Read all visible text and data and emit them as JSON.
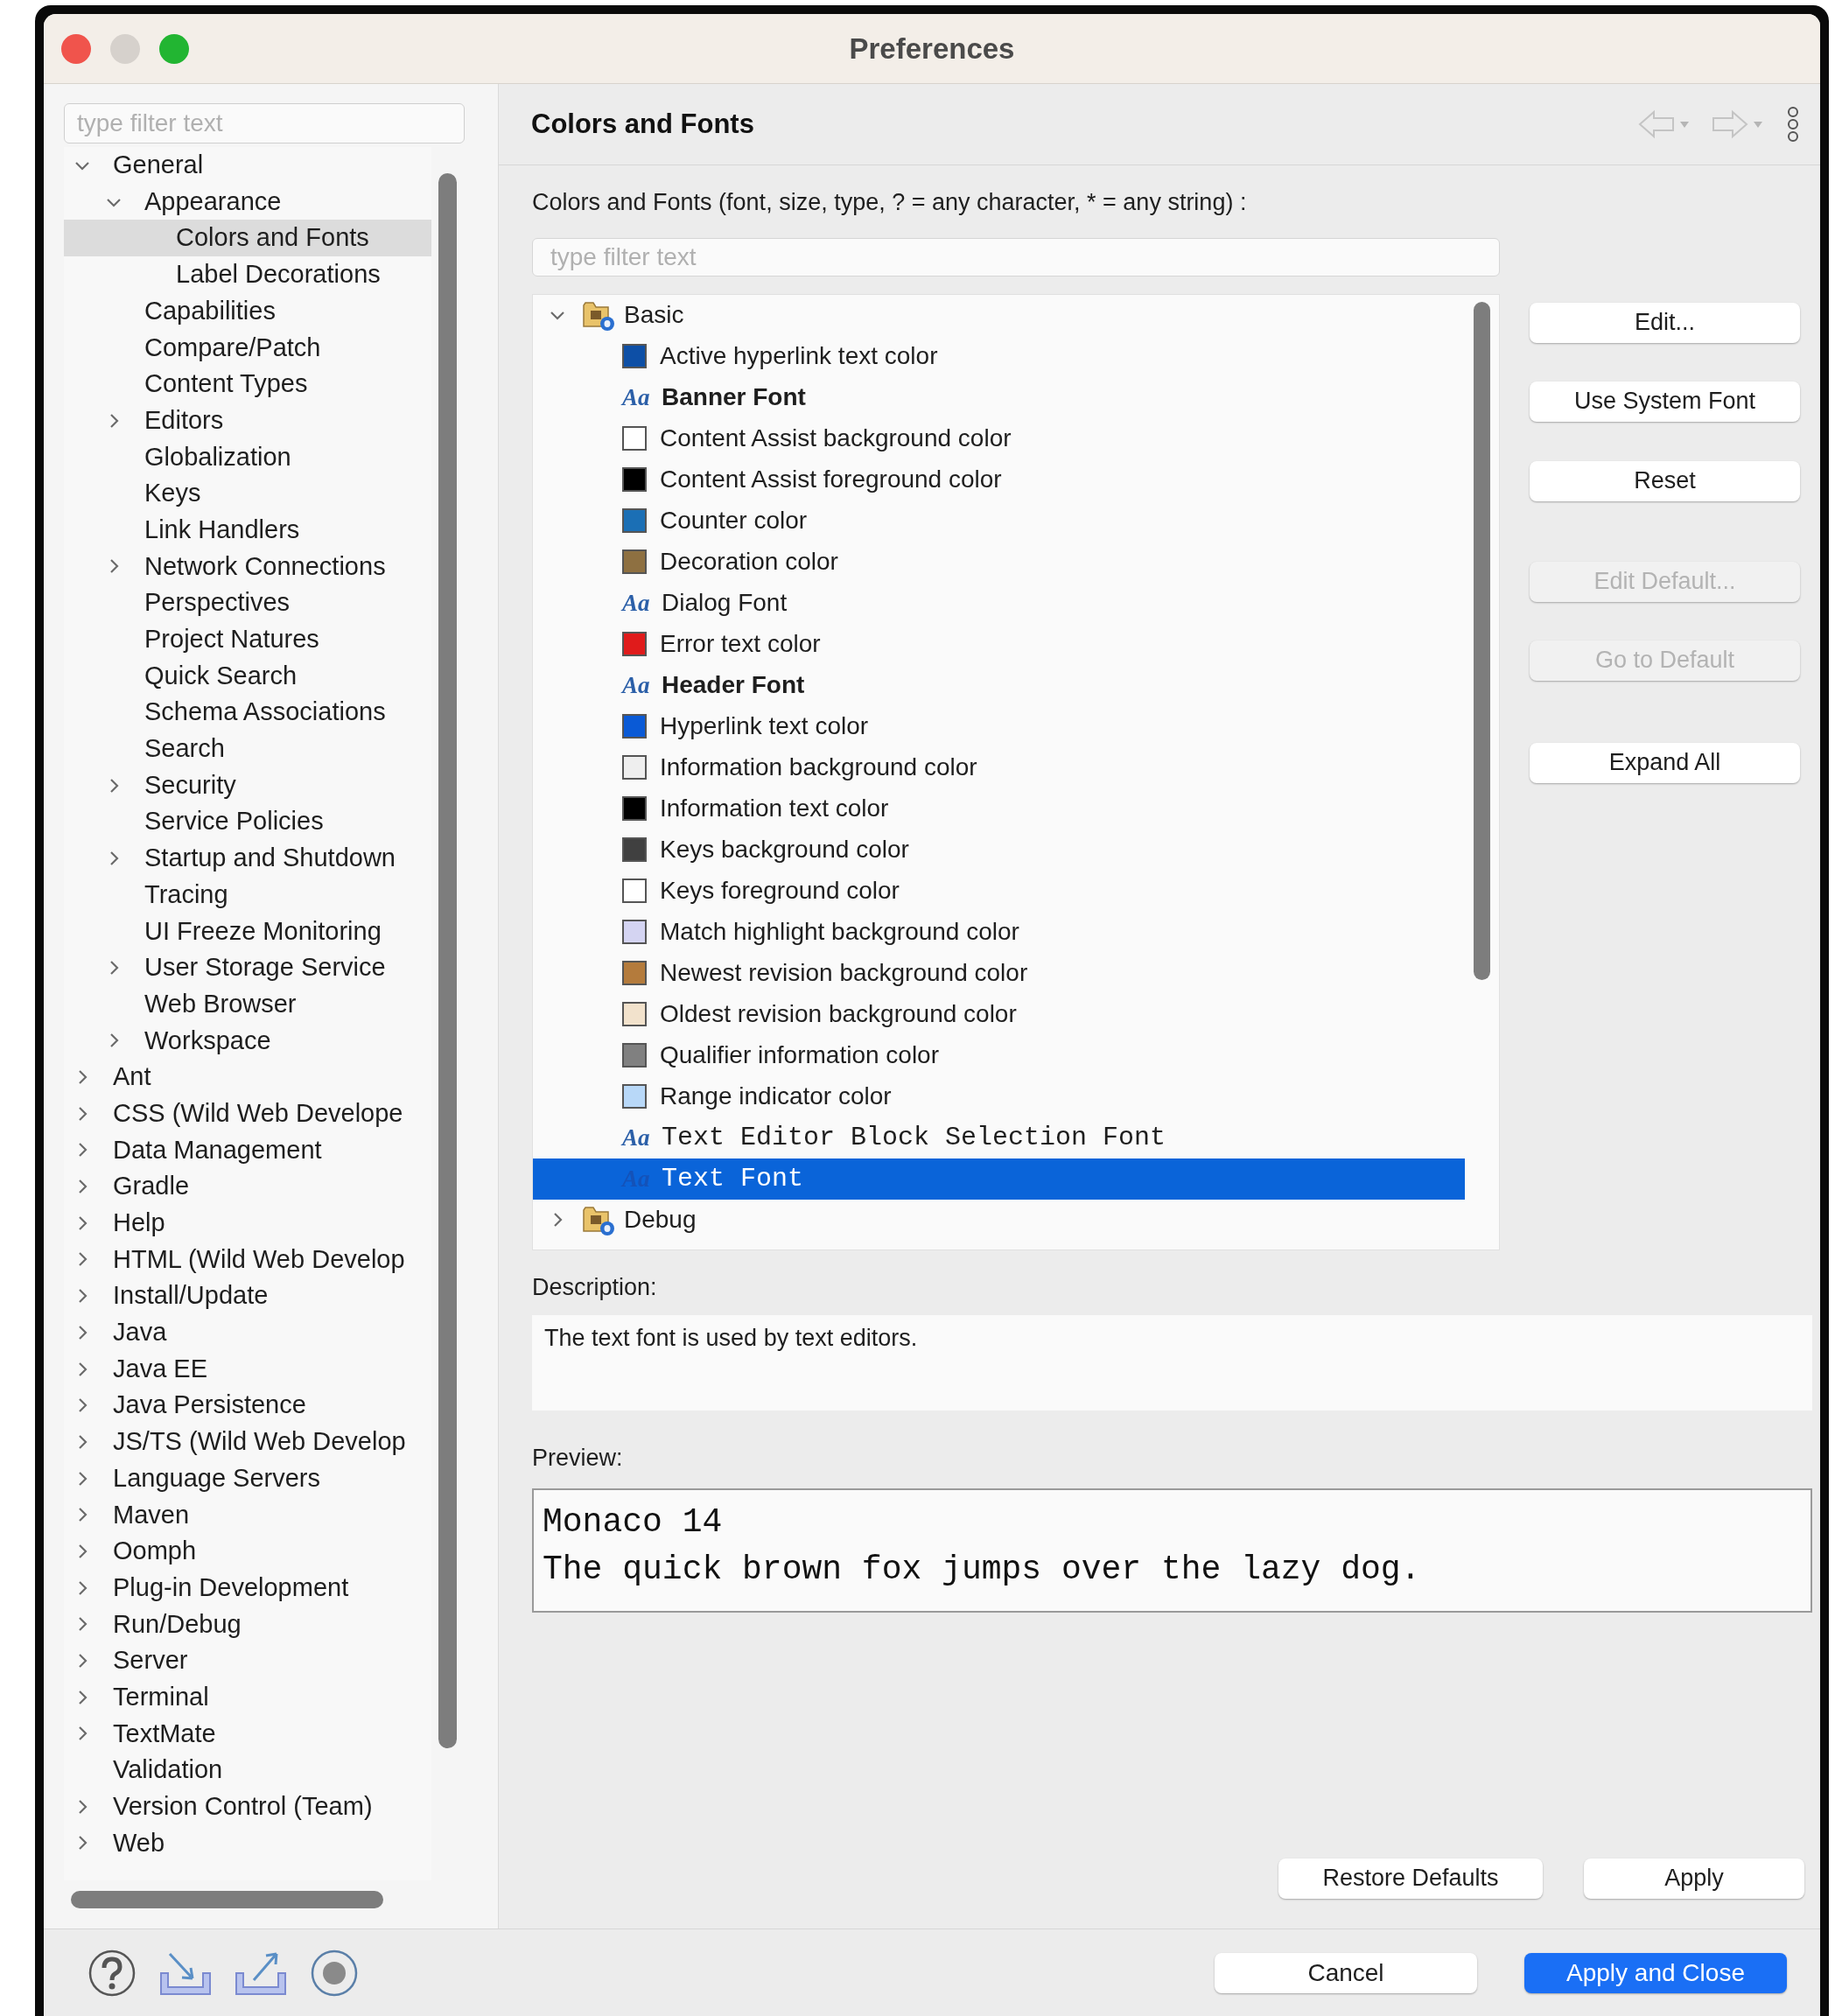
{
  "window": {
    "title": "Preferences"
  },
  "sidebar": {
    "filter": {
      "placeholder": "type filter text"
    },
    "tree": [
      {
        "label": "General",
        "expanded": true,
        "selected": false,
        "children": [
          {
            "label": "Appearance",
            "expanded": true,
            "selected": false,
            "children": [
              {
                "label": "Colors and Fonts",
                "selected": true
              },
              {
                "label": "Label Decorations",
                "selected": false
              }
            ]
          },
          {
            "label": "Capabilities",
            "selected": false
          },
          {
            "label": "Compare/Patch",
            "selected": false
          },
          {
            "label": "Content Types",
            "selected": false
          },
          {
            "label": "Editors",
            "expanded": false,
            "selected": false
          },
          {
            "label": "Globalization",
            "selected": false
          },
          {
            "label": "Keys",
            "selected": false
          },
          {
            "label": "Link Handlers",
            "selected": false
          },
          {
            "label": "Network Connections",
            "expanded": false,
            "selected": false
          },
          {
            "label": "Perspectives",
            "selected": false
          },
          {
            "label": "Project Natures",
            "selected": false
          },
          {
            "label": "Quick Search",
            "selected": false
          },
          {
            "label": "Schema Associations",
            "selected": false
          },
          {
            "label": "Search",
            "selected": false
          },
          {
            "label": "Security",
            "expanded": false,
            "selected": false
          },
          {
            "label": "Service Policies",
            "selected": false
          },
          {
            "label": "Startup and Shutdown",
            "expanded": false,
            "selected": false
          },
          {
            "label": "Tracing",
            "selected": false
          },
          {
            "label": "UI Freeze Monitoring",
            "selected": false
          },
          {
            "label": "User Storage Service",
            "expanded": false,
            "selected": false
          },
          {
            "label": "Web Browser",
            "selected": false
          },
          {
            "label": "Workspace",
            "expanded": false,
            "selected": false
          }
        ]
      },
      {
        "label": "Ant",
        "expanded": false,
        "selected": false
      },
      {
        "label": "CSS (Wild Web Develope",
        "expanded": false,
        "selected": false
      },
      {
        "label": "Data Management",
        "expanded": false,
        "selected": false
      },
      {
        "label": "Gradle",
        "expanded": false,
        "selected": false
      },
      {
        "label": "Help",
        "expanded": false,
        "selected": false
      },
      {
        "label": "HTML (Wild Web Develop",
        "expanded": false,
        "selected": false
      },
      {
        "label": "Install/Update",
        "expanded": false,
        "selected": false
      },
      {
        "label": "Java",
        "expanded": false,
        "selected": false
      },
      {
        "label": "Java EE",
        "expanded": false,
        "selected": false
      },
      {
        "label": "Java Persistence",
        "expanded": false,
        "selected": false
      },
      {
        "label": "JS/TS (Wild Web Develop",
        "expanded": false,
        "selected": false
      },
      {
        "label": "Language Servers",
        "expanded": false,
        "selected": false
      },
      {
        "label": "Maven",
        "expanded": false,
        "selected": false
      },
      {
        "label": "Oomph",
        "expanded": false,
        "selected": false
      },
      {
        "label": "Plug-in Development",
        "expanded": false,
        "selected": false
      },
      {
        "label": "Run/Debug",
        "expanded": false,
        "selected": false
      },
      {
        "label": "Server",
        "expanded": false,
        "selected": false
      },
      {
        "label": "Terminal",
        "expanded": false,
        "selected": false
      },
      {
        "label": "TextMate",
        "expanded": false,
        "selected": false
      },
      {
        "label": "Validation",
        "selected": false
      },
      {
        "label": "Version Control (Team)",
        "expanded": false,
        "selected": false
      },
      {
        "label": "Web",
        "expanded": false,
        "selected": false
      }
    ]
  },
  "page": {
    "title": "Colors and Fonts",
    "filter_label": "Colors and Fonts (font, size, type, ? = any character, * = any string) :",
    "filter": {
      "placeholder": "type filter text"
    },
    "tree": [
      {
        "label": "Basic",
        "expanded": true,
        "selected": false,
        "children": [
          {
            "label": "Active hyperlink text color",
            "kind": "color",
            "color": "#0d4fa6",
            "selected": false
          },
          {
            "label": "Banner Font",
            "kind": "boldfont",
            "icon": "Aa",
            "selected": false
          },
          {
            "label": "Content Assist background color",
            "kind": "color",
            "color": "#ffffff",
            "selected": false
          },
          {
            "label": "Content Assist foreground color",
            "kind": "color",
            "color": "#000000",
            "selected": false
          },
          {
            "label": "Counter color",
            "kind": "color",
            "color": "#1b6fb5",
            "selected": false
          },
          {
            "label": "Decoration color",
            "kind": "color",
            "color": "#8e7041",
            "selected": false
          },
          {
            "label": "Dialog Font",
            "kind": "font",
            "icon": "Aa",
            "selected": false
          },
          {
            "label": "Error text color",
            "kind": "color",
            "color": "#e01b1b",
            "selected": false
          },
          {
            "label": "Header Font",
            "kind": "boldfont",
            "icon": "Aa",
            "selected": false
          },
          {
            "label": "Hyperlink text color",
            "kind": "color",
            "color": "#0a5ad6",
            "selected": false
          },
          {
            "label": "Information background color",
            "kind": "color",
            "color": "#eeeeee",
            "selected": false
          },
          {
            "label": "Information text color",
            "kind": "color",
            "color": "#000000",
            "selected": false
          },
          {
            "label": "Keys background color",
            "kind": "color",
            "color": "#404040",
            "selected": false
          },
          {
            "label": "Keys foreground color",
            "kind": "color",
            "color": "#ffffff",
            "selected": false
          },
          {
            "label": "Match highlight background color",
            "kind": "color",
            "color": "#d4d4f2",
            "selected": false
          },
          {
            "label": "Newest revision background color",
            "kind": "color",
            "color": "#b47b3c",
            "selected": false
          },
          {
            "label": "Oldest revision background color",
            "kind": "color",
            "color": "#f2e2cc",
            "selected": false
          },
          {
            "label": "Qualifier information color",
            "kind": "color",
            "color": "#808080",
            "selected": false
          },
          {
            "label": "Range indicator color",
            "kind": "color",
            "color": "#b8d8f8",
            "selected": false
          },
          {
            "label": "Text Editor Block Selection Font",
            "kind": "monofont",
            "icon": "Aa",
            "selected": false
          },
          {
            "label": "Text Font",
            "kind": "monofont",
            "icon": "Aa",
            "selected": true
          }
        ]
      },
      {
        "label": "Debug",
        "expanded": false,
        "selected": false
      }
    ],
    "buttons": [
      {
        "label": "Edit...",
        "disabled": false
      },
      {
        "label": "Use System Font",
        "disabled": false
      },
      {
        "label": "Reset",
        "disabled": false
      },
      {
        "label": "Edit Default...",
        "disabled": true
      },
      {
        "label": "Go to Default",
        "disabled": true
      },
      {
        "label": "Expand All",
        "disabled": false
      }
    ],
    "description_label": "Description:",
    "description": "The text font is used by text editors.",
    "preview_label": "Preview:",
    "preview_lines": [
      "Monaco 14",
      "The quick brown fox jumps over the lazy dog."
    ],
    "page_buttons": [
      {
        "label": "Restore Defaults"
      },
      {
        "label": "Apply"
      }
    ]
  },
  "footer_buttons": [
    {
      "label": "Cancel",
      "primary": false
    },
    {
      "label": "Apply and Close",
      "primary": true
    }
  ]
}
